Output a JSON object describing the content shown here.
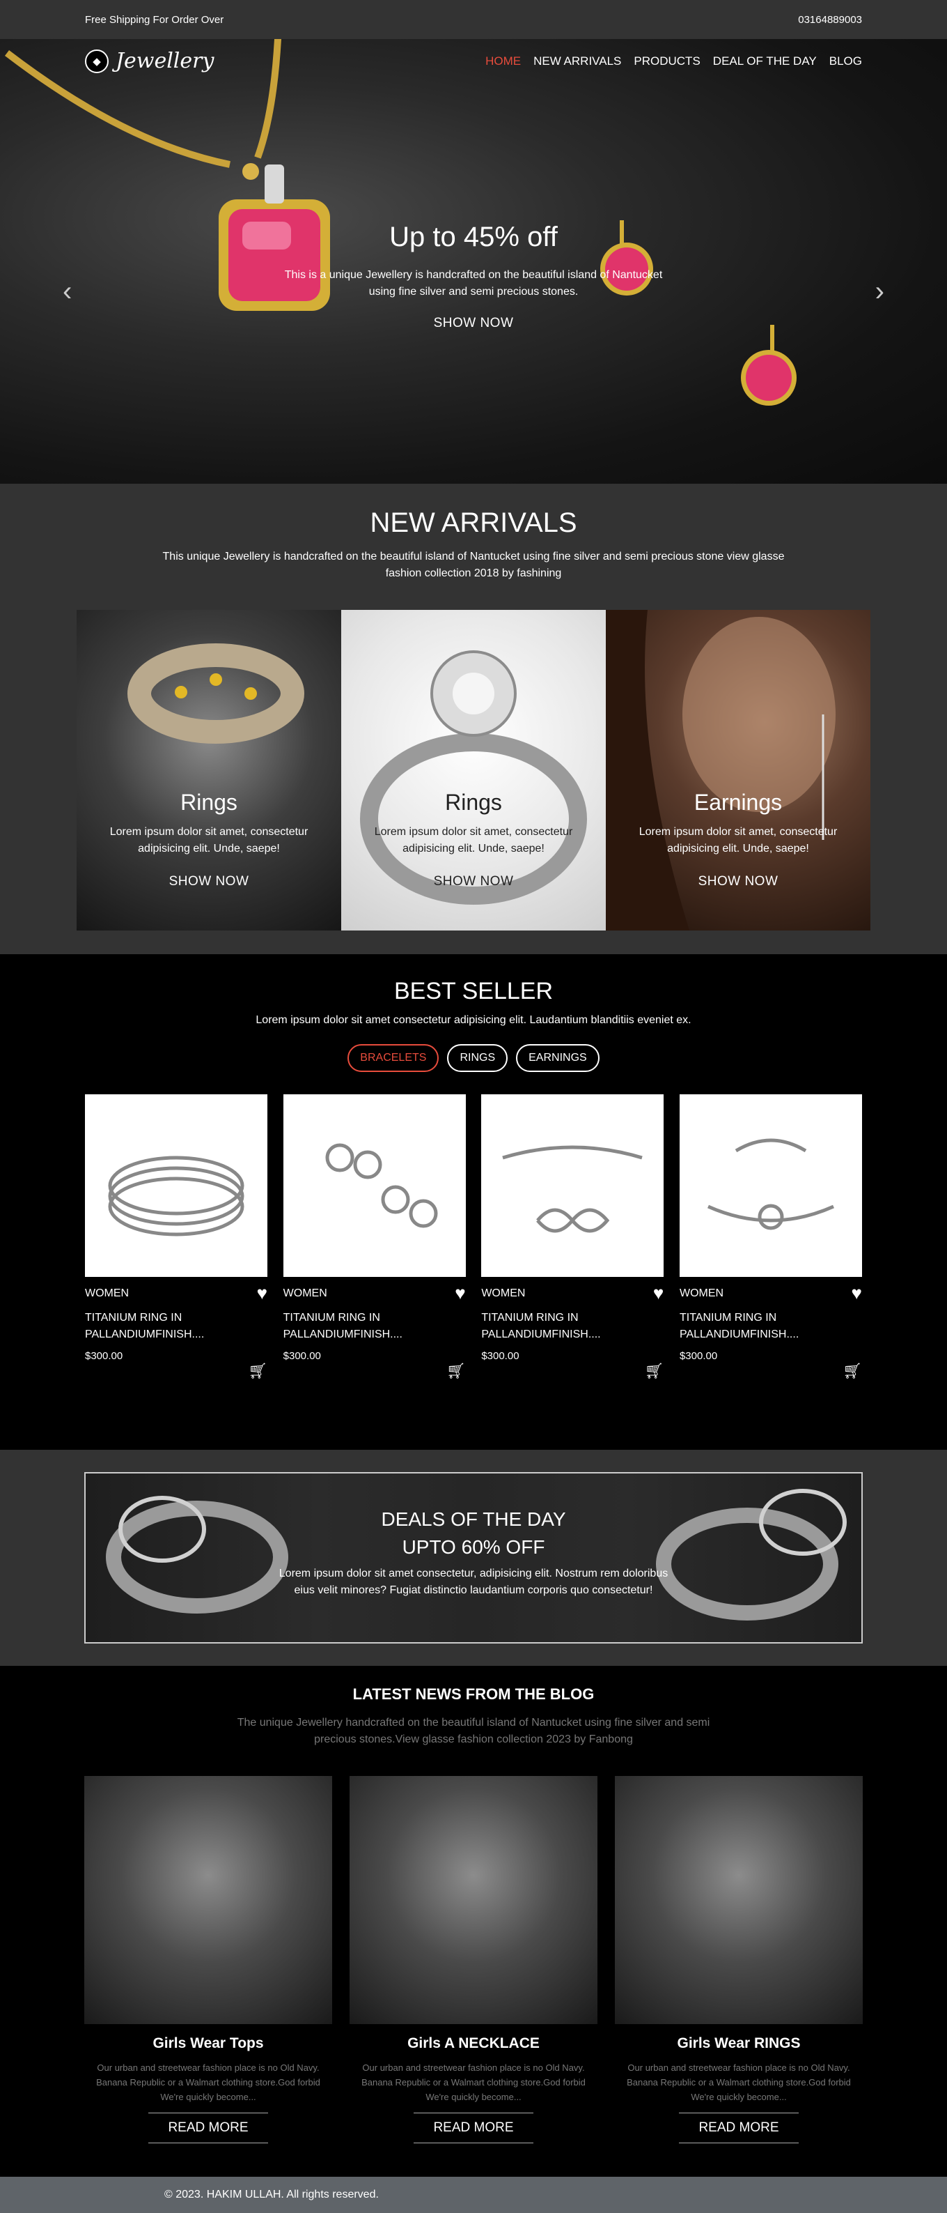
{
  "topbar": {
    "shipping": "Free Shipping For Order Over",
    "phone": "03164889003"
  },
  "nav": {
    "logo": "Jewellery",
    "items": [
      {
        "label": "HOME",
        "active": true
      },
      {
        "label": "NEW ARRIVALS"
      },
      {
        "label": "PRODUCTS"
      },
      {
        "label": "DEAL OF THE DAY"
      },
      {
        "label": "BLOG"
      }
    ]
  },
  "hero": {
    "title": "Up to 45% off",
    "text": "This is a unique Jewellery is handcrafted on the beautiful island of Nantucket using fine silver and semi precious stones.",
    "cta": "SHOW NOW",
    "prev_arrow": "‹",
    "next_arrow": "›"
  },
  "arrivals": {
    "title": "NEW ARRIVALS",
    "subtitle": "This unique Jewellery is handcrafted on the beautiful island of Nantucket using fine silver and semi precious stone view glasse fashion collection 2018 by fashining",
    "cards": [
      {
        "title": "Rings",
        "text": "Lorem ipsum dolor sit amet, consectetur adipisicing elit. Unde, saepe!",
        "cta": "SHOW NOW"
      },
      {
        "title": "Rings",
        "text": "Lorem ipsum dolor sit amet, consectetur adipisicing elit. Unde, saepe!",
        "cta": "SHOW NOW"
      },
      {
        "title": "Earnings",
        "text": "Lorem ipsum dolor sit amet, consectetur adipisicing elit. Unde, saepe!",
        "cta": "SHOW NOW"
      }
    ]
  },
  "bestseller": {
    "title": "BEST SELLER",
    "subtitle": "Lorem ipsum dolor sit amet consectetur adipisicing elit. Laudantium blanditiis eveniet ex.",
    "filters": [
      {
        "label": "BRACELETS",
        "active": true
      },
      {
        "label": "RINGS"
      },
      {
        "label": "EARNINGS"
      }
    ],
    "products": [
      {
        "category": "WOMEN",
        "name": "TITANIUM RING IN PALLANDIUMFINISH....",
        "price": "$300.00"
      },
      {
        "category": "WOMEN",
        "name": "TITANIUM RING IN PALLANDIUMFINISH....",
        "price": "$300.00"
      },
      {
        "category": "WOMEN",
        "name": "TITANIUM RING IN PALLANDIUMFINISH....",
        "price": "$300.00"
      },
      {
        "category": "WOMEN",
        "name": "TITANIUM RING IN PALLANDIUMFINISH....",
        "price": "$300.00"
      }
    ]
  },
  "deals": {
    "title1": "DEALS OF THE DAY",
    "title2": "UPTO 60% OFF",
    "text": "Lorem ipsum dolor sit amet consectetur, adipisicing elit. Nostrum rem doloribus eius velit minores? Fugiat distinctio laudantium corporis quo consectetur!"
  },
  "blog": {
    "title": "LATEST NEWS FROM THE BLOG",
    "subtitle": "The unique Jewellery handcrafted on the beautiful island of Nantucket using fine silver and semi precious stones.View glasse fashion collection 2023 by Fanbong",
    "posts": [
      {
        "title": "Girls Wear Tops",
        "text": "Our urban and streetwear fashion place is no Old Navy. Banana Republic or a Walmart clothing store.God forbid We're quickly become...",
        "cta": "READ MORE"
      },
      {
        "title": "Girls A NECKLACE",
        "text": "Our urban and streetwear fashion place is no Old Navy. Banana Republic or a Walmart clothing store.God forbid We're quickly become...",
        "cta": "READ MORE"
      },
      {
        "title": "Girls Wear RINGS",
        "text": "Our urban and streetwear fashion place is no Old Navy. Banana Republic or a Walmart clothing store.God forbid We're quickly become...",
        "cta": "READ MORE"
      }
    ]
  },
  "footer": {
    "text": "© 2023. HAKIM ULLAH. All rights reserved."
  },
  "colors": {
    "accent": "#e74c3c",
    "topbar": "#333333",
    "footer": "#5f6469"
  }
}
